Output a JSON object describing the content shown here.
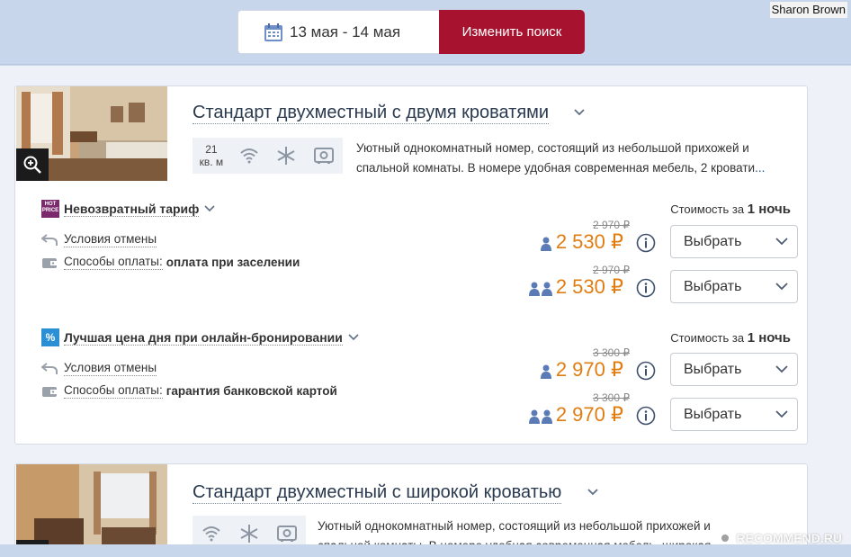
{
  "search": {
    "dates": "13 мая - 14 мая",
    "change_label": "Изменить поиск"
  },
  "watermark": {
    "user": "Sharon Brown",
    "site": "RECOMMEND.RU"
  },
  "rooms": [
    {
      "title": "Стандарт двухместный с двумя кроватями",
      "area_value": "21",
      "area_unit": "кв. м",
      "description": "Уютный однокомнатный номер, состоящий из небольшой прихожей и спальной комнаты. В номере удобная современная мебель, 2 кровати",
      "more": "...",
      "tariffs": [
        {
          "name": "Невозвратный тариф",
          "badge": "HOT PRICE",
          "cost_for_label": "Стоимость за",
          "cost_for_value": "1 ночь",
          "cancel_label": "Условия отмены",
          "payment_label": "Способы оплаты:",
          "payment_value": "оплата при заселении",
          "prices": [
            {
              "old": "2 970 ₽",
              "new": "2 530 ₽",
              "guests": 1,
              "button": "Выбрать"
            },
            {
              "old": "2 970 ₽",
              "new": "2 530 ₽",
              "guests": 2,
              "button": "Выбрать"
            }
          ]
        },
        {
          "name": "Лучшая цена дня при онлайн-бронировании",
          "badge": "%",
          "cost_for_label": "Стоимость за",
          "cost_for_value": "1 ночь",
          "cancel_label": "Условия отмены",
          "payment_label": "Способы оплаты:",
          "payment_value": "гарантия банковской картой",
          "prices": [
            {
              "old": "3 300 ₽",
              "new": "2 970 ₽",
              "guests": 1,
              "button": "Выбрать"
            },
            {
              "old": "3 300 ₽",
              "new": "2 970 ₽",
              "guests": 2,
              "button": "Выбрать"
            }
          ]
        }
      ]
    },
    {
      "title": "Стандарт двухместный с широкой кроватью",
      "description": "Уютный однокомнатный номер, состоящий из небольшой прихожей и спальной комнаты. В номере удобная современная мебель, широкая кровать"
    }
  ],
  "colors": {
    "accent": "#a7122e",
    "price": "#e07d12",
    "link": "#1a4fa0",
    "icon_blue": "#5a7bb5"
  }
}
